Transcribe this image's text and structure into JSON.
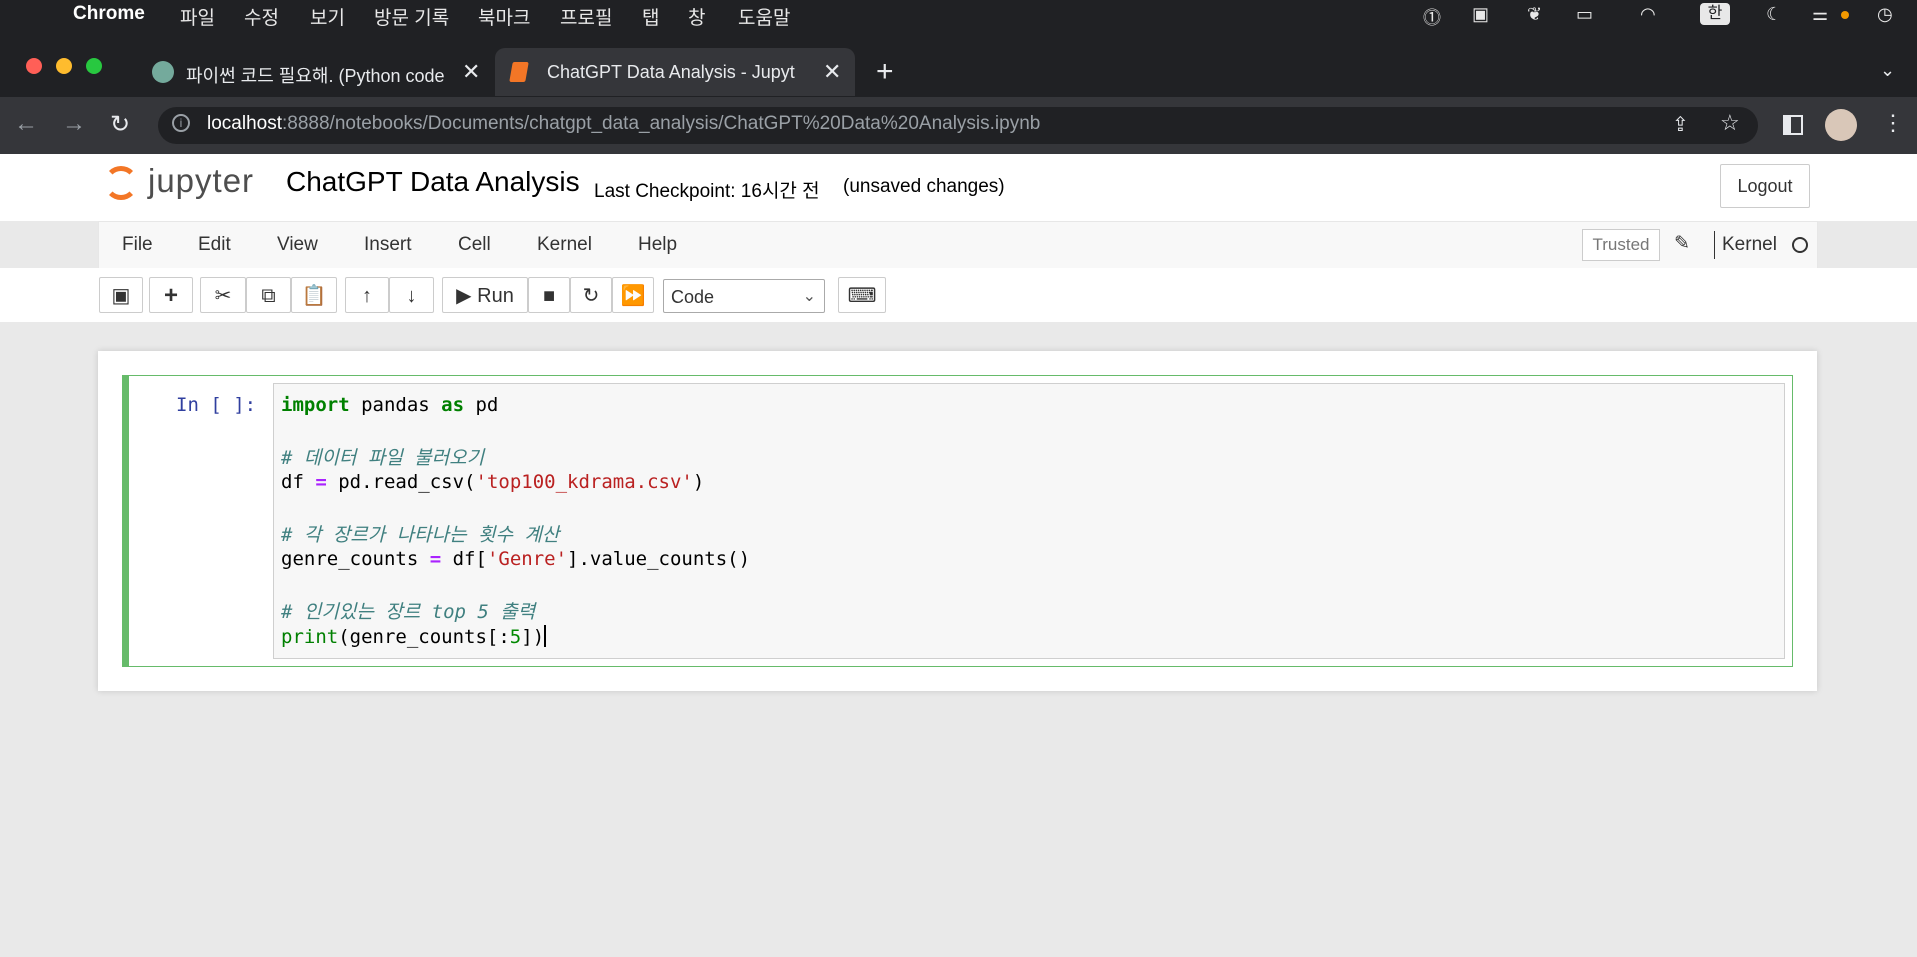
{
  "menubar": {
    "app": "Chrome",
    "items": [
      "파일",
      "수정",
      "보기",
      "방문 기록",
      "북마크",
      "프로필",
      "탭",
      "창",
      "도움말"
    ],
    "input_indicator": "한"
  },
  "tabs": [
    {
      "label": "파이썬 코드 필요해. (Python code"
    },
    {
      "label": "ChatGPT Data Analysis - Jupyt"
    }
  ],
  "address": {
    "host": "localhost",
    "path": ":8888/notebooks/Documents/chatgpt_data_analysis/ChatGPT%20Data%20Analysis.ipynb"
  },
  "jupyter": {
    "logo": "jupyter",
    "title": "ChatGPT Data Analysis",
    "checkpoint": "Last Checkpoint: 16시간 전",
    "unsaved": "(unsaved changes)",
    "logout": "Logout",
    "menu": [
      "File",
      "Edit",
      "View",
      "Insert",
      "Cell",
      "Kernel",
      "Help"
    ],
    "trusted": "Trusted",
    "kernel": "Kernel",
    "run_label": "Run",
    "cell_type": "Code"
  },
  "cell": {
    "prompt": "In [ ]:",
    "lines": {
      "l1_kw1": "import",
      "l1_mod": " pandas ",
      "l1_kw2": "as",
      "l1_alias": " pd",
      "l2": "# 데이터 파일 불러오기",
      "l3_a": "df ",
      "l3_op": "=",
      "l3_b": " pd.read_csv(",
      "l3_str": "'top100_kdrama.csv'",
      "l3_c": ")",
      "l4": "# 각 장르가 나타나는 횟수 계산",
      "l5_a": "genre_counts ",
      "l5_op": "=",
      "l5_b": " df[",
      "l5_str": "'Genre'",
      "l5_c": "].value_counts()",
      "l6": "# 인기있는 장르 top 5 출력",
      "l7_fn": "print",
      "l7_a": "(genre_counts[:",
      "l7_num": "5",
      "l7_b": "])"
    }
  },
  "colors": {
    "cell_border": "#66bb6a",
    "keyword": "#008000",
    "comment": "#408080",
    "string": "#ba2121",
    "operator": "#aa22ff",
    "prompt": "#303f9f"
  }
}
